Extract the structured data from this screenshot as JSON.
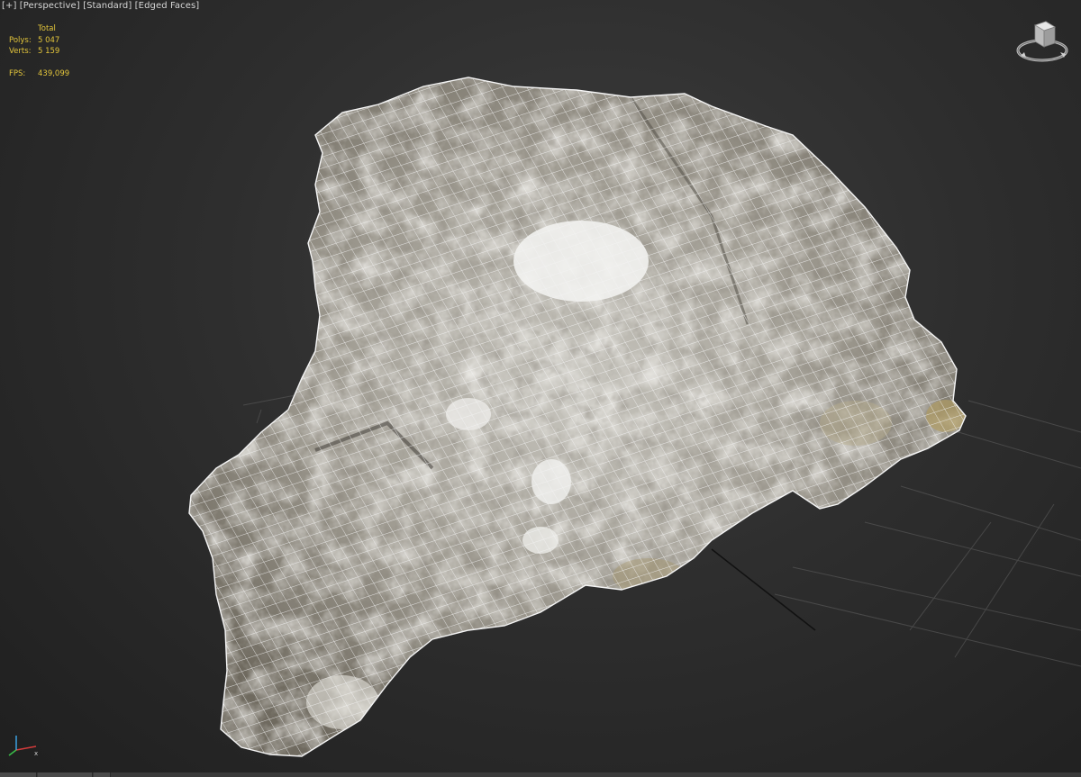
{
  "viewport": {
    "labels": [
      "[+]",
      "[Perspective]",
      "[Standard]",
      "[Edged Faces]"
    ],
    "stats": {
      "total_label": "Total",
      "polys_label": "Polys:",
      "polys_value": "5 047",
      "verts_label": "Verts:",
      "verts_value": "5 159",
      "fps_label": "FPS:",
      "fps_value": "439,099"
    },
    "stats_color": "#e3c53b",
    "object": "scanned rock mesh with edged faces wireframe",
    "icons": {
      "viewcube": "viewcube-icon",
      "axis": "axis-tripod-icon"
    }
  }
}
